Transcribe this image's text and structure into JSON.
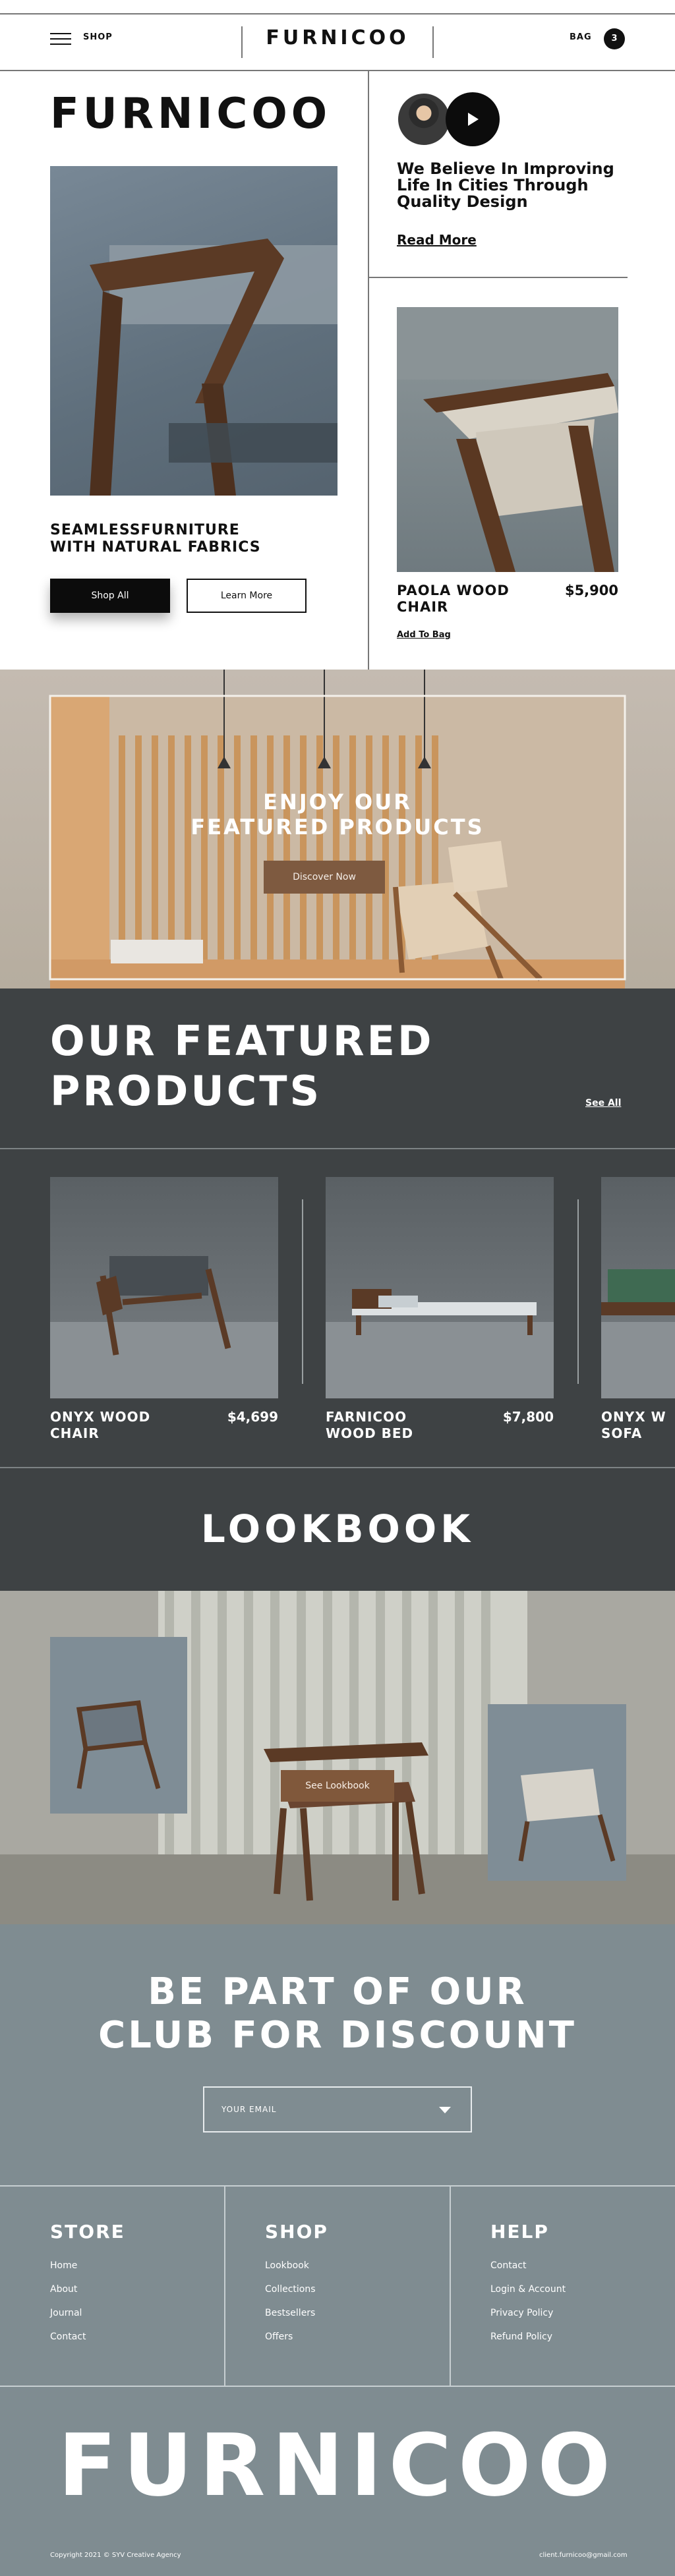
{
  "header": {
    "shop_label": "SHOP",
    "logo": "FURNICOO",
    "bag_label": "BAG",
    "bag_count": "3"
  },
  "hero": {
    "logo": "FURNICOO",
    "tagline_line1": "SEAMLESSFURNITURE",
    "tagline_line2": "WITH NATURAL FABRICS",
    "shop_all": "Shop All",
    "learn_more": "Learn More"
  },
  "about": {
    "believe_line1": "We Believe In Improving",
    "believe_line2": "Life In Cities Through",
    "believe_line3": "Quality Design",
    "read_more": "Read More"
  },
  "spotlight": {
    "name_line1": "PAOLA WOOD",
    "name_line2": "CHAIR",
    "price": "$5,900",
    "add_to_bag": "Add To Bag"
  },
  "banner": {
    "title_line1": "ENJOY OUR",
    "title_line2": "FEATURED PRODUCTS",
    "cta": "Discover Now"
  },
  "featured": {
    "title_line1": "OUR FEATURED",
    "title_line2": "PRODUCTS",
    "see_all": "See All",
    "products": [
      {
        "name_line1": "ONYX WOOD",
        "name_line2": "CHAIR",
        "price": "$4,699"
      },
      {
        "name_line1": "FARNICOO",
        "name_line2": "WOOD BED",
        "price": "$7,800"
      },
      {
        "name_line1": "ONYX W",
        "name_line2": "SOFA",
        "price": ""
      }
    ]
  },
  "lookbook": {
    "title": "LOOKBOOK",
    "cta": "See Lookbook"
  },
  "club": {
    "title_line1": "BE PART OF OUR",
    "title_line2": "CLUB FOR DISCOUNT",
    "email_placeholder": "YOUR EMAIL"
  },
  "footer": {
    "columns": [
      {
        "heading": "STORE",
        "links": [
          "Home",
          "About",
          "Journal",
          "Contact"
        ]
      },
      {
        "heading": "SHOP",
        "links": [
          "Lookbook",
          "Collections",
          "Bestsellers",
          "Offers"
        ]
      },
      {
        "heading": "HELP",
        "links": [
          "Contact",
          "Login & Account",
          "Privacy Policy",
          "Refund Policy"
        ]
      }
    ],
    "big_logo": "FURNICOO",
    "copyright": "Copyright 2021 © SYV Creative Agency",
    "email": "client.furnicoo@gmail.com"
  },
  "colors": {
    "dark_section": "#3e4244",
    "slate": "#7f8c91",
    "accent_brown": "#7e5a40",
    "black": "#0c0c0c"
  },
  "icons": [
    "hamburger-menu-icon",
    "play-icon",
    "chevron-down-icon"
  ]
}
